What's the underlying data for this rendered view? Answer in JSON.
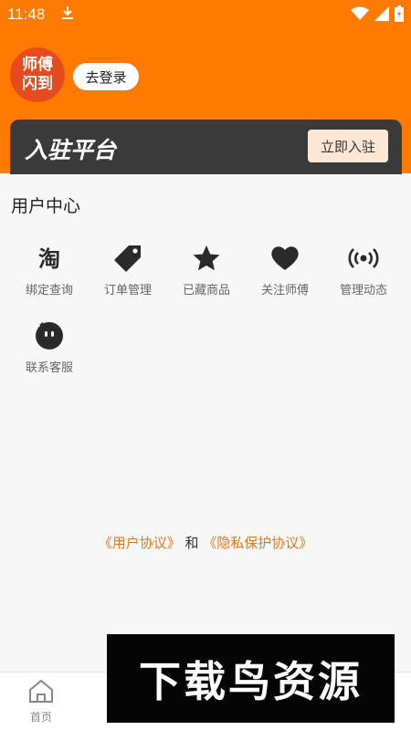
{
  "status": {
    "time": "11:48"
  },
  "header": {
    "logo_line1": "师傅",
    "logo_line2": "闪到",
    "login_label": "去登录"
  },
  "platform": {
    "title": "入驻平台",
    "button_label": "立即入驻"
  },
  "user_center": {
    "title": "用户中心",
    "items": [
      {
        "label": "绑定查询",
        "icon": "taobao-icon"
      },
      {
        "label": "订单管理",
        "icon": "tag-icon"
      },
      {
        "label": "已藏商品",
        "icon": "star-icon"
      },
      {
        "label": "关注师傅",
        "icon": "heart-icon"
      },
      {
        "label": "管理动态",
        "icon": "broadcast-icon"
      },
      {
        "label": "联系客服",
        "icon": "chat-bubble-icon"
      }
    ]
  },
  "agreement": {
    "link1": "《用户协议》",
    "and": "和",
    "link2": "《隐私保护协议》"
  },
  "bottom_nav": {
    "home_label": "首页"
  },
  "watermark": {
    "text": "下载鸟资源"
  },
  "colors": {
    "brand_orange": "#ff7a00",
    "link_orange": "#e6791e",
    "card_dark": "#3a3a3a"
  }
}
